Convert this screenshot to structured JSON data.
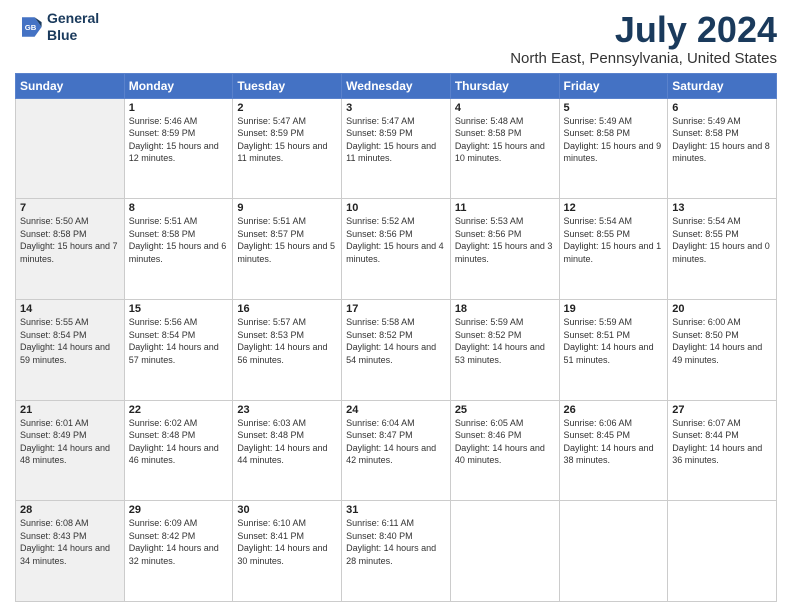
{
  "logo": {
    "line1": "General",
    "line2": "Blue"
  },
  "title": "July 2024",
  "subtitle": "North East, Pennsylvania, United States",
  "weekdays": [
    "Sunday",
    "Monday",
    "Tuesday",
    "Wednesday",
    "Thursday",
    "Friday",
    "Saturday"
  ],
  "weeks": [
    [
      {
        "day": "",
        "sunrise": "",
        "sunset": "",
        "daylight": ""
      },
      {
        "day": "1",
        "sunrise": "Sunrise: 5:46 AM",
        "sunset": "Sunset: 8:59 PM",
        "daylight": "Daylight: 15 hours and 12 minutes."
      },
      {
        "day": "2",
        "sunrise": "Sunrise: 5:47 AM",
        "sunset": "Sunset: 8:59 PM",
        "daylight": "Daylight: 15 hours and 11 minutes."
      },
      {
        "day": "3",
        "sunrise": "Sunrise: 5:47 AM",
        "sunset": "Sunset: 8:59 PM",
        "daylight": "Daylight: 15 hours and 11 minutes."
      },
      {
        "day": "4",
        "sunrise": "Sunrise: 5:48 AM",
        "sunset": "Sunset: 8:58 PM",
        "daylight": "Daylight: 15 hours and 10 minutes."
      },
      {
        "day": "5",
        "sunrise": "Sunrise: 5:49 AM",
        "sunset": "Sunset: 8:58 PM",
        "daylight": "Daylight: 15 hours and 9 minutes."
      },
      {
        "day": "6",
        "sunrise": "Sunrise: 5:49 AM",
        "sunset": "Sunset: 8:58 PM",
        "daylight": "Daylight: 15 hours and 8 minutes."
      }
    ],
    [
      {
        "day": "7",
        "sunrise": "Sunrise: 5:50 AM",
        "sunset": "Sunset: 8:58 PM",
        "daylight": "Daylight: 15 hours and 7 minutes."
      },
      {
        "day": "8",
        "sunrise": "Sunrise: 5:51 AM",
        "sunset": "Sunset: 8:58 PM",
        "daylight": "Daylight: 15 hours and 6 minutes."
      },
      {
        "day": "9",
        "sunrise": "Sunrise: 5:51 AM",
        "sunset": "Sunset: 8:57 PM",
        "daylight": "Daylight: 15 hours and 5 minutes."
      },
      {
        "day": "10",
        "sunrise": "Sunrise: 5:52 AM",
        "sunset": "Sunset: 8:56 PM",
        "daylight": "Daylight: 15 hours and 4 minutes."
      },
      {
        "day": "11",
        "sunrise": "Sunrise: 5:53 AM",
        "sunset": "Sunset: 8:56 PM",
        "daylight": "Daylight: 15 hours and 3 minutes."
      },
      {
        "day": "12",
        "sunrise": "Sunrise: 5:54 AM",
        "sunset": "Sunset: 8:55 PM",
        "daylight": "Daylight: 15 hours and 1 minute."
      },
      {
        "day": "13",
        "sunrise": "Sunrise: 5:54 AM",
        "sunset": "Sunset: 8:55 PM",
        "daylight": "Daylight: 15 hours and 0 minutes."
      }
    ],
    [
      {
        "day": "14",
        "sunrise": "Sunrise: 5:55 AM",
        "sunset": "Sunset: 8:54 PM",
        "daylight": "Daylight: 14 hours and 59 minutes."
      },
      {
        "day": "15",
        "sunrise": "Sunrise: 5:56 AM",
        "sunset": "Sunset: 8:54 PM",
        "daylight": "Daylight: 14 hours and 57 minutes."
      },
      {
        "day": "16",
        "sunrise": "Sunrise: 5:57 AM",
        "sunset": "Sunset: 8:53 PM",
        "daylight": "Daylight: 14 hours and 56 minutes."
      },
      {
        "day": "17",
        "sunrise": "Sunrise: 5:58 AM",
        "sunset": "Sunset: 8:52 PM",
        "daylight": "Daylight: 14 hours and 54 minutes."
      },
      {
        "day": "18",
        "sunrise": "Sunrise: 5:59 AM",
        "sunset": "Sunset: 8:52 PM",
        "daylight": "Daylight: 14 hours and 53 minutes."
      },
      {
        "day": "19",
        "sunrise": "Sunrise: 5:59 AM",
        "sunset": "Sunset: 8:51 PM",
        "daylight": "Daylight: 14 hours and 51 minutes."
      },
      {
        "day": "20",
        "sunrise": "Sunrise: 6:00 AM",
        "sunset": "Sunset: 8:50 PM",
        "daylight": "Daylight: 14 hours and 49 minutes."
      }
    ],
    [
      {
        "day": "21",
        "sunrise": "Sunrise: 6:01 AM",
        "sunset": "Sunset: 8:49 PM",
        "daylight": "Daylight: 14 hours and 48 minutes."
      },
      {
        "day": "22",
        "sunrise": "Sunrise: 6:02 AM",
        "sunset": "Sunset: 8:48 PM",
        "daylight": "Daylight: 14 hours and 46 minutes."
      },
      {
        "day": "23",
        "sunrise": "Sunrise: 6:03 AM",
        "sunset": "Sunset: 8:48 PM",
        "daylight": "Daylight: 14 hours and 44 minutes."
      },
      {
        "day": "24",
        "sunrise": "Sunrise: 6:04 AM",
        "sunset": "Sunset: 8:47 PM",
        "daylight": "Daylight: 14 hours and 42 minutes."
      },
      {
        "day": "25",
        "sunrise": "Sunrise: 6:05 AM",
        "sunset": "Sunset: 8:46 PM",
        "daylight": "Daylight: 14 hours and 40 minutes."
      },
      {
        "day": "26",
        "sunrise": "Sunrise: 6:06 AM",
        "sunset": "Sunset: 8:45 PM",
        "daylight": "Daylight: 14 hours and 38 minutes."
      },
      {
        "day": "27",
        "sunrise": "Sunrise: 6:07 AM",
        "sunset": "Sunset: 8:44 PM",
        "daylight": "Daylight: 14 hours and 36 minutes."
      }
    ],
    [
      {
        "day": "28",
        "sunrise": "Sunrise: 6:08 AM",
        "sunset": "Sunset: 8:43 PM",
        "daylight": "Daylight: 14 hours and 34 minutes."
      },
      {
        "day": "29",
        "sunrise": "Sunrise: 6:09 AM",
        "sunset": "Sunset: 8:42 PM",
        "daylight": "Daylight: 14 hours and 32 minutes."
      },
      {
        "day": "30",
        "sunrise": "Sunrise: 6:10 AM",
        "sunset": "Sunset: 8:41 PM",
        "daylight": "Daylight: 14 hours and 30 minutes."
      },
      {
        "day": "31",
        "sunrise": "Sunrise: 6:11 AM",
        "sunset": "Sunset: 8:40 PM",
        "daylight": "Daylight: 14 hours and 28 minutes."
      },
      {
        "day": "",
        "sunrise": "",
        "sunset": "",
        "daylight": ""
      },
      {
        "day": "",
        "sunrise": "",
        "sunset": "",
        "daylight": ""
      },
      {
        "day": "",
        "sunrise": "",
        "sunset": "",
        "daylight": ""
      }
    ]
  ]
}
